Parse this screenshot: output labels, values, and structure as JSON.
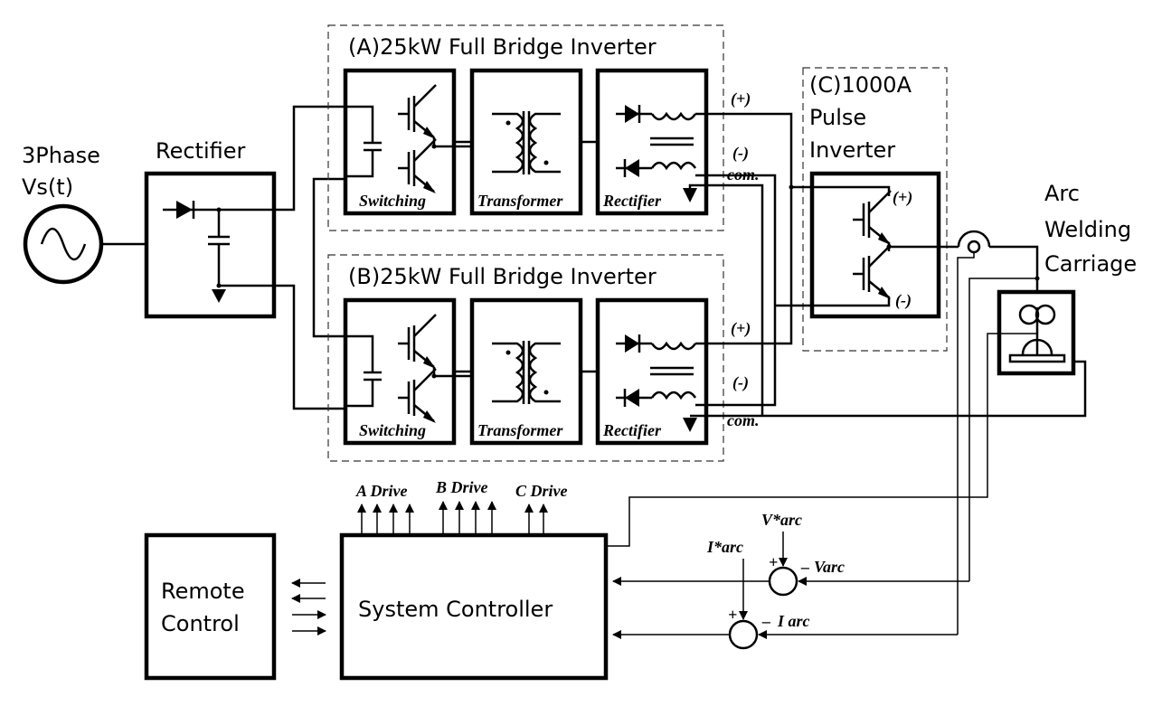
{
  "source": {
    "line1": "3Phase",
    "line2": "Vs(t)"
  },
  "rectifier": {
    "title": "Rectifier"
  },
  "inverter_a": {
    "title": "(A)25kW Full Bridge Inverter",
    "blocks": [
      "Switching",
      "Transformer",
      "Rectifier"
    ],
    "plus": "(+)",
    "minus": "(-)",
    "com": "com."
  },
  "inverter_b": {
    "title": "(B)25kW Full Bridge Inverter",
    "blocks": [
      "Switching",
      "Transformer",
      "Rectifier"
    ],
    "plus": "(+)",
    "minus": "(-)",
    "com": "com."
  },
  "pulse_inverter": {
    "line1": "(C)1000A",
    "line2": "Pulse",
    "line3": "Inverter",
    "plus": "(+)",
    "minus": "(-)"
  },
  "carriage": {
    "line1": "Arc",
    "line2": "Welding",
    "line3": "Carriage"
  },
  "controller": {
    "title": "System Controller",
    "drives": [
      "A Drive",
      "B Drive",
      "C Drive"
    ]
  },
  "remote": {
    "line1": "Remote",
    "line2": "Control"
  },
  "feedback": {
    "v_ref": "V*arc",
    "v_meas": "Varc",
    "i_ref": "I*arc",
    "i_meas": "I arc",
    "plus": "+",
    "minus": "–"
  }
}
